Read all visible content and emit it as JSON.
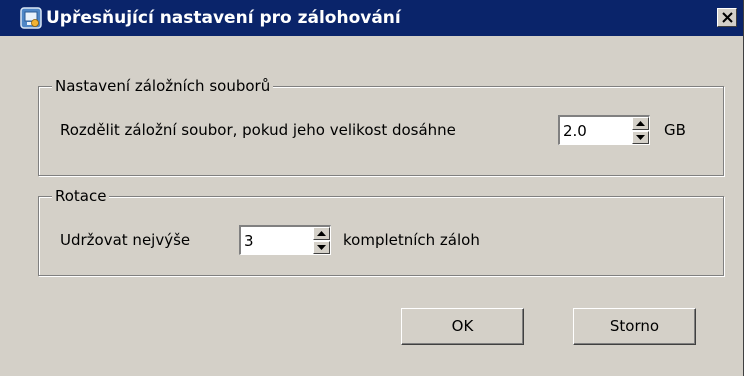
{
  "window": {
    "title": "Upřesňující nastavení pro zálohování",
    "icon": "backup-app-icon",
    "close_icon": "close-icon"
  },
  "backup_files_group": {
    "legend": "Nastavení záložních souborů",
    "split_label": "Rozdělit záložní soubor, pokud jeho velikost dosáhne",
    "split_value": "2.0",
    "split_unit": "GB"
  },
  "rotation_group": {
    "legend": "Rotace",
    "keep_label": "Udržovat nejvýše",
    "keep_value": "3",
    "keep_suffix": "kompletních záloh"
  },
  "buttons": {
    "ok": "OK",
    "cancel": "Storno"
  },
  "colors": {
    "titlebar": "#0a246a",
    "face": "#d4d0c8"
  }
}
